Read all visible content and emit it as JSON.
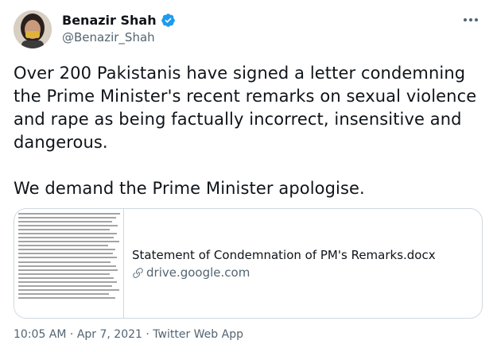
{
  "author": {
    "display_name": "Benazir Shah",
    "handle": "@Benazir_Shah",
    "verified": true,
    "icons": {
      "verified": "verified-badge-icon",
      "more": "more-options-icon"
    }
  },
  "tweet": {
    "text": "Over 200 Pakistanis have signed a letter condemning the Prime Minister's recent remarks on sexual violence and rape as being factually incorrect, insensitive and dangerous.\n\nWe demand the Prime Minister apologise."
  },
  "card": {
    "title": "Statement of Condemnation of PM's Remarks.docx",
    "domain": "drive.google.com",
    "link_icon": "link-icon"
  },
  "meta": {
    "time": "10:05 AM",
    "separator_1": " · ",
    "date": "Apr 7, 2021",
    "separator_2": " · ",
    "source": "Twitter Web App"
  },
  "colors": {
    "text": "#0f1419",
    "secondary": "#536471",
    "verified": "#1d9bf0",
    "border": "#cfd9de"
  }
}
